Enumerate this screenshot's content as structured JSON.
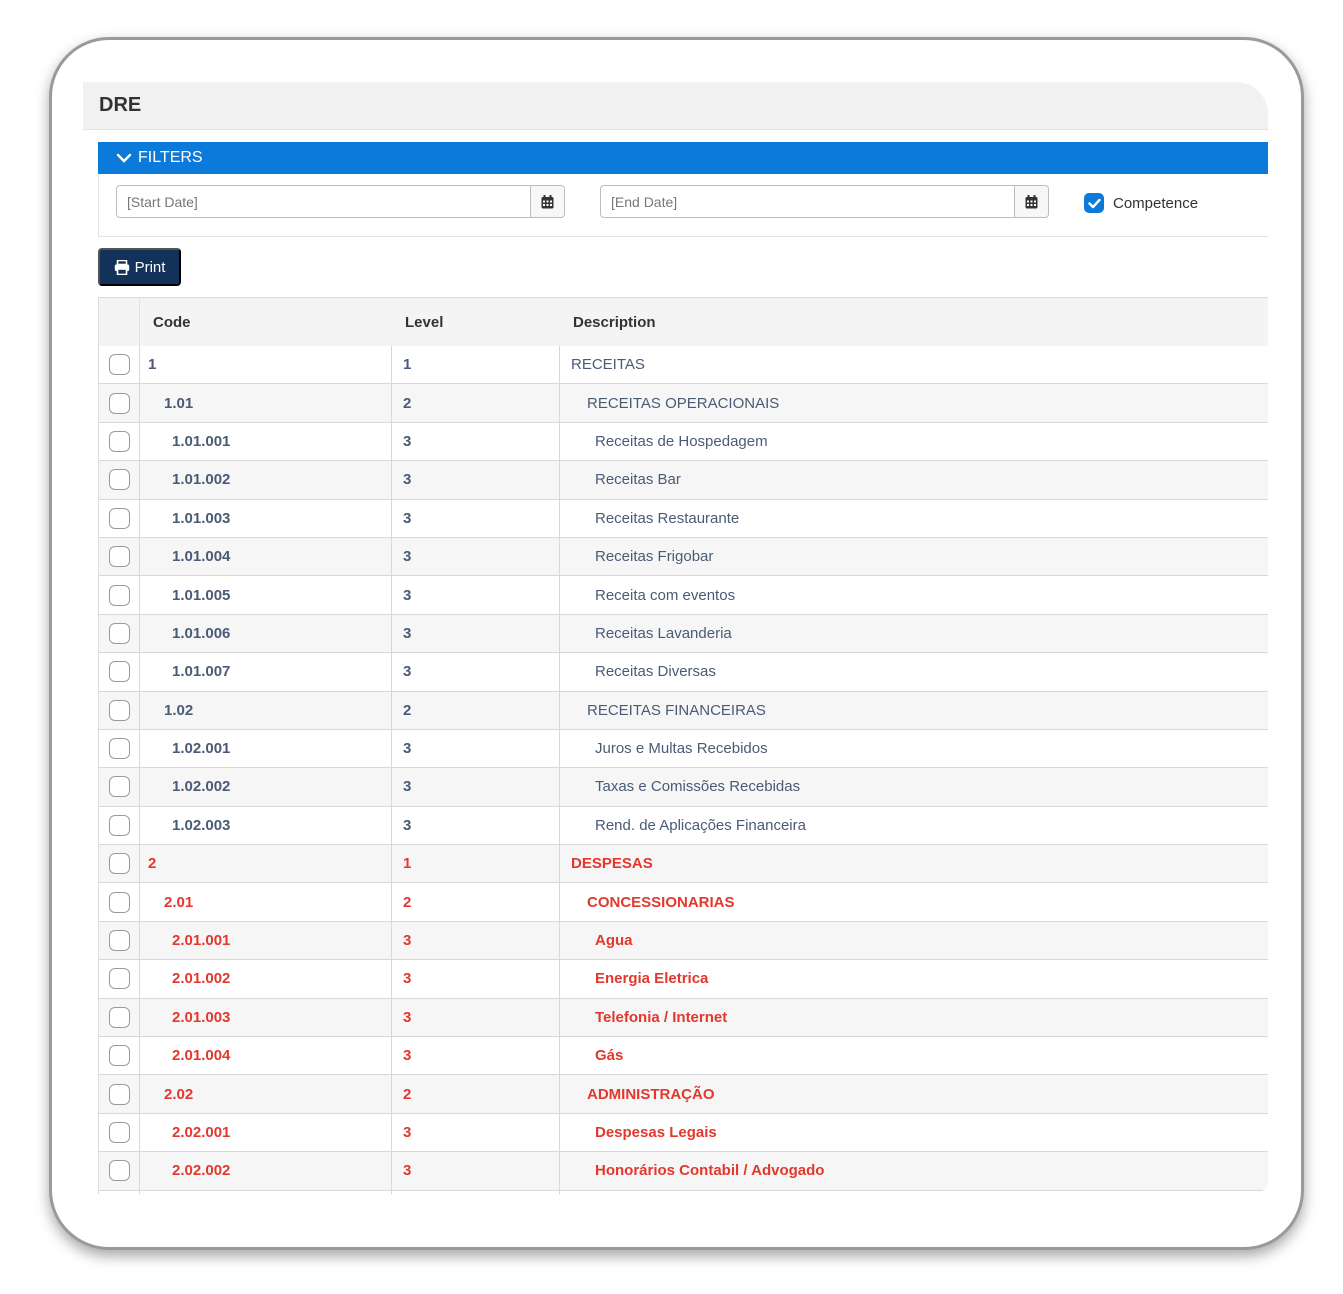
{
  "page": {
    "title": "DRE"
  },
  "filters": {
    "header_label": "FILTERS",
    "start_date_placeholder": "[Start Date]",
    "end_date_placeholder": "[End Date]",
    "competence_label": "Competence",
    "competence_checked": true
  },
  "toolbar": {
    "print_label": "Print"
  },
  "table": {
    "columns": [
      "Code",
      "Level",
      "Description"
    ],
    "rows": [
      {
        "code": "1",
        "level": "1",
        "description": "RECEITAS",
        "type": "revenue"
      },
      {
        "code": "1.01",
        "level": "2",
        "description": "RECEITAS OPERACIONAIS",
        "type": "revenue"
      },
      {
        "code": "1.01.001",
        "level": "3",
        "description": "Receitas de Hospedagem",
        "type": "revenue"
      },
      {
        "code": "1.01.002",
        "level": "3",
        "description": "Receitas Bar",
        "type": "revenue"
      },
      {
        "code": "1.01.003",
        "level": "3",
        "description": "Receitas Restaurante",
        "type": "revenue"
      },
      {
        "code": "1.01.004",
        "level": "3",
        "description": "Receitas Frigobar",
        "type": "revenue"
      },
      {
        "code": "1.01.005",
        "level": "3",
        "description": "Receita com eventos",
        "type": "revenue"
      },
      {
        "code": "1.01.006",
        "level": "3",
        "description": "Receitas Lavanderia",
        "type": "revenue"
      },
      {
        "code": "1.01.007",
        "level": "3",
        "description": "Receitas Diversas",
        "type": "revenue"
      },
      {
        "code": "1.02",
        "level": "2",
        "description": "RECEITAS FINANCEIRAS",
        "type": "revenue"
      },
      {
        "code": "1.02.001",
        "level": "3",
        "description": "Juros e Multas Recebidos",
        "type": "revenue"
      },
      {
        "code": "1.02.002",
        "level": "3",
        "description": "Taxas e Comissões Recebidas",
        "type": "revenue"
      },
      {
        "code": "1.02.003",
        "level": "3",
        "description": "Rend. de Aplicações Financeira",
        "type": "revenue"
      },
      {
        "code": "2",
        "level": "1",
        "description": "DESPESAS",
        "type": "expense"
      },
      {
        "code": "2.01",
        "level": "2",
        "description": "CONCESSIONARIAS",
        "type": "expense"
      },
      {
        "code": "2.01.001",
        "level": "3",
        "description": "Agua",
        "type": "expense"
      },
      {
        "code": "2.01.002",
        "level": "3",
        "description": "Energia Eletrica",
        "type": "expense"
      },
      {
        "code": "2.01.003",
        "level": "3",
        "description": "Telefonia / Internet",
        "type": "expense"
      },
      {
        "code": "2.01.004",
        "level": "3",
        "description": "Gás",
        "type": "expense"
      },
      {
        "code": "2.02",
        "level": "2",
        "description": "ADMINISTRAÇÃO",
        "type": "expense"
      },
      {
        "code": "2.02.001",
        "level": "3",
        "description": "Despesas Legais",
        "type": "expense"
      },
      {
        "code": "2.02.002",
        "level": "3",
        "description": "Honorários Contabil / Advogado",
        "type": "expense"
      }
    ]
  },
  "colors": {
    "accent": "#0b7ad8",
    "print_button": "#12325a",
    "revenue_text": "#4a5b75",
    "expense_text": "#e2382d"
  },
  "icons": {
    "filters_toggle": "chevron-down-icon",
    "date_picker": "calendar-icon",
    "print": "printer-icon",
    "competence": "checkbox-checked-icon"
  }
}
